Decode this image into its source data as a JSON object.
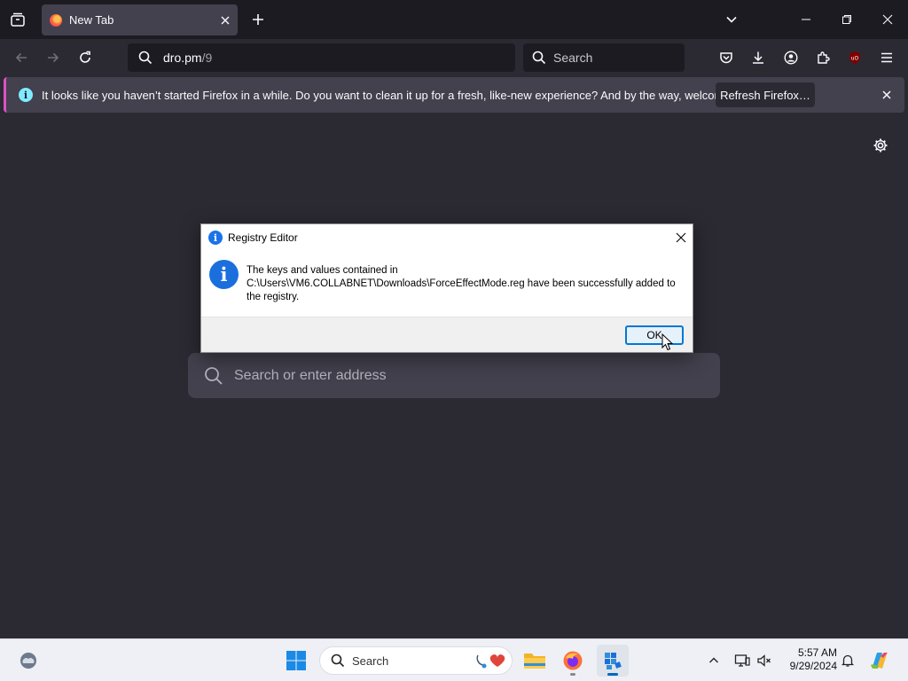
{
  "browser": {
    "tab": {
      "title": "New Tab"
    },
    "url": {
      "host": "dro.pm",
      "path": "/9"
    },
    "search": {
      "placeholder": "Search"
    },
    "notification": {
      "message": "It looks like you haven’t started Firefox in a while. Do you want to clean it up for a fresh, like-new experience? And by the way, welcome back!",
      "button": "Refresh Firefox…"
    },
    "newtab_search": {
      "placeholder": "Search or enter address"
    }
  },
  "dialog": {
    "title": "Registry Editor",
    "message_line1": "The keys and values contained in",
    "message_line2": "C:\\Users\\VM6.COLLABNET\\Downloads\\ForceEffectMode.reg have been successfully added to",
    "message_line3": "the registry.",
    "ok_label": "OK"
  },
  "taskbar": {
    "search_placeholder": "Search",
    "time": "5:57 AM",
    "date": "9/29/2024"
  },
  "icons": {
    "tab_list": "tab-list-icon",
    "favicon": "firefox-icon",
    "toolbar": [
      "pocket-icon",
      "download-icon",
      "account-icon",
      "extensions-icon",
      "ublock-icon",
      "menu-icon"
    ],
    "tray": [
      "chevron-up-icon",
      "network-icon",
      "volume-icon",
      "bell-icon",
      "copilot-icon"
    ]
  },
  "colors": {
    "background": "#2b2a33",
    "tabstrip": "#1c1b22",
    "accent": "#0078d4",
    "notification_accent": "#e04fc8"
  }
}
